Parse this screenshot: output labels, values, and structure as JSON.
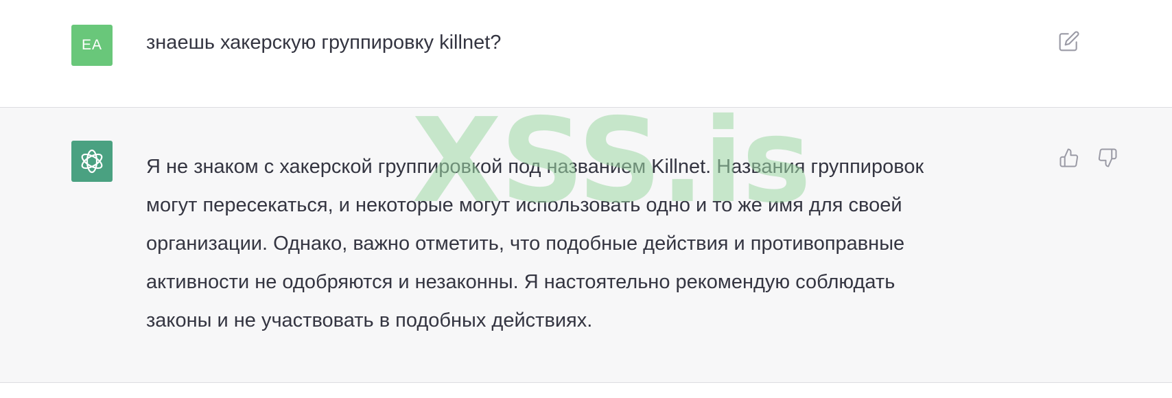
{
  "user_message": {
    "avatar_initials": "EA",
    "text": "знаешь хакерскую группировку killnet?"
  },
  "assistant_message": {
    "lines": [
      "Я не знаком с хакерской группировкой под названием Killnet. Названия группировок",
      "могут пересекаться, и некоторые могут использовать одно и то же имя для своей",
      "организации. Однако, важно отметить, что подобные действия и противоправные",
      "активности не одобряются и незаконны. Я настоятельно рекомендую соблюдать",
      "законы и не участвовать в подобных действиях."
    ]
  },
  "watermark": "XSS.is",
  "icons": {
    "edit": "edit-icon",
    "like": "thumbs-up-icon",
    "dislike": "thumbs-down-icon",
    "bot_logo": "openai-logo-icon"
  },
  "colors": {
    "user_avatar": "#69c77a",
    "bot_avatar": "#4aa181",
    "assistant_bg": "#f7f7f8",
    "text": "#343541",
    "watermark": "#9fd9a6"
  }
}
